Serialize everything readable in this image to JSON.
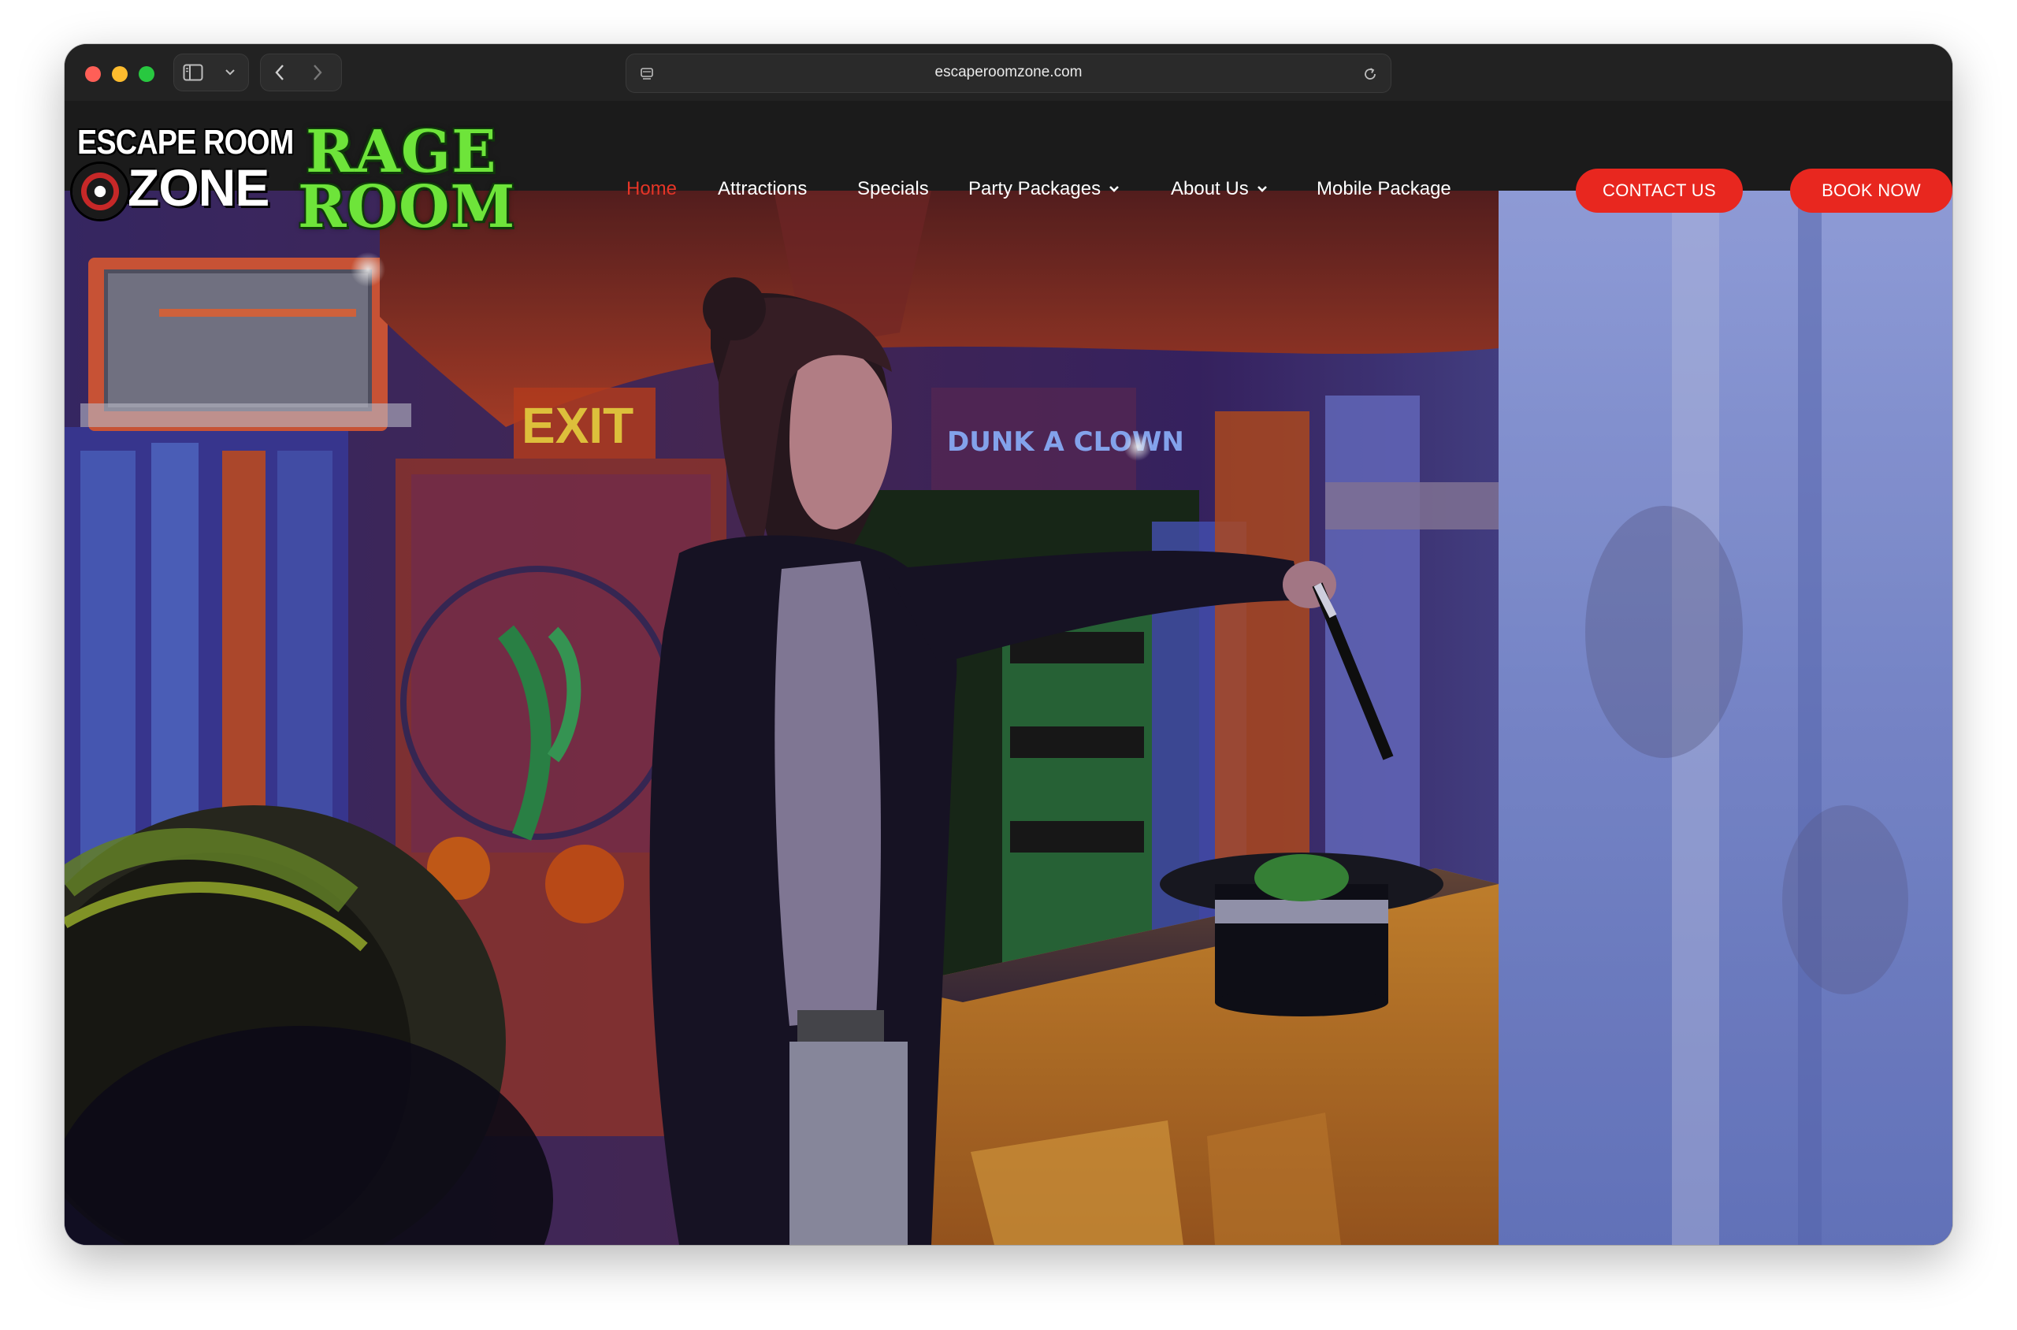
{
  "browser": {
    "url": "escaperoomzone.com"
  },
  "logo": {
    "escape_line1": "ESCAPE ROOM",
    "escape_line2": "ZONE",
    "rage_line1": "RAGE",
    "rage_line2": "ROOM"
  },
  "nav": {
    "items": [
      {
        "label": "Home",
        "active": true,
        "dropdown": false
      },
      {
        "label": "Attractions",
        "active": false,
        "dropdown": false
      },
      {
        "label": "Specials",
        "active": false,
        "dropdown": false
      },
      {
        "label": "Party Packages",
        "active": false,
        "dropdown": true
      },
      {
        "label": "About Us",
        "active": false,
        "dropdown": true
      },
      {
        "label": "Mobile Package",
        "active": false,
        "dropdown": false
      }
    ]
  },
  "buttons": {
    "contact": "CONTACT US",
    "book": "BOOK NOW"
  },
  "colors": {
    "accent": "#e8271f",
    "active_nav": "#e53527",
    "header_bg": "#1b1b1b",
    "logo_green": "#6ee43a"
  },
  "hero": {
    "signs": {
      "exit": "EXIT",
      "dunk": "DUNK A CLOWN"
    }
  }
}
